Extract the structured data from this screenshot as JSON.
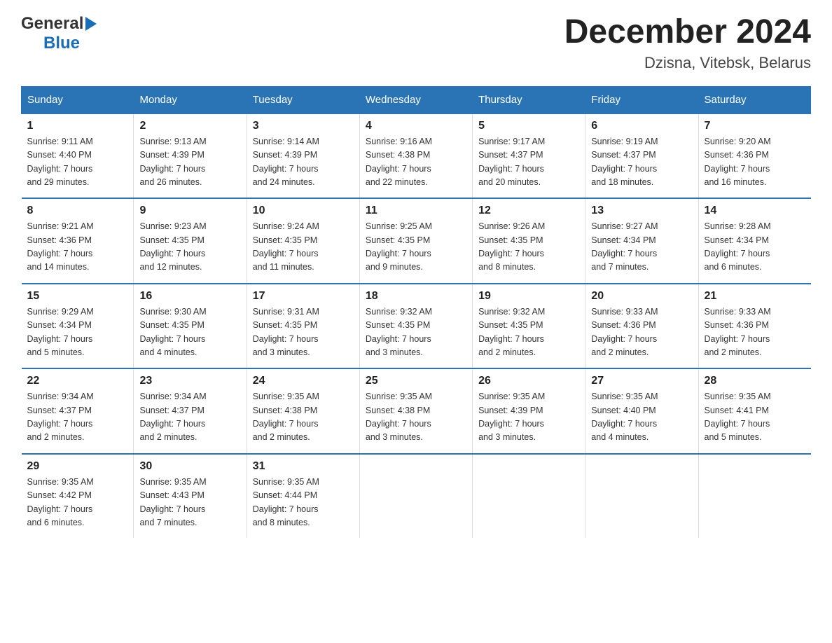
{
  "header": {
    "logo_general": "General",
    "logo_blue": "Blue",
    "title": "December 2024",
    "subtitle": "Dzisna, Vitebsk, Belarus"
  },
  "days_of_week": [
    "Sunday",
    "Monday",
    "Tuesday",
    "Wednesday",
    "Thursday",
    "Friday",
    "Saturday"
  ],
  "weeks": [
    [
      {
        "day": "1",
        "sunrise": "Sunrise: 9:11 AM",
        "sunset": "Sunset: 4:40 PM",
        "daylight": "Daylight: 7 hours",
        "daylight2": "and 29 minutes."
      },
      {
        "day": "2",
        "sunrise": "Sunrise: 9:13 AM",
        "sunset": "Sunset: 4:39 PM",
        "daylight": "Daylight: 7 hours",
        "daylight2": "and 26 minutes."
      },
      {
        "day": "3",
        "sunrise": "Sunrise: 9:14 AM",
        "sunset": "Sunset: 4:39 PM",
        "daylight": "Daylight: 7 hours",
        "daylight2": "and 24 minutes."
      },
      {
        "day": "4",
        "sunrise": "Sunrise: 9:16 AM",
        "sunset": "Sunset: 4:38 PM",
        "daylight": "Daylight: 7 hours",
        "daylight2": "and 22 minutes."
      },
      {
        "day": "5",
        "sunrise": "Sunrise: 9:17 AM",
        "sunset": "Sunset: 4:37 PM",
        "daylight": "Daylight: 7 hours",
        "daylight2": "and 20 minutes."
      },
      {
        "day": "6",
        "sunrise": "Sunrise: 9:19 AM",
        "sunset": "Sunset: 4:37 PM",
        "daylight": "Daylight: 7 hours",
        "daylight2": "and 18 minutes."
      },
      {
        "day": "7",
        "sunrise": "Sunrise: 9:20 AM",
        "sunset": "Sunset: 4:36 PM",
        "daylight": "Daylight: 7 hours",
        "daylight2": "and 16 minutes."
      }
    ],
    [
      {
        "day": "8",
        "sunrise": "Sunrise: 9:21 AM",
        "sunset": "Sunset: 4:36 PM",
        "daylight": "Daylight: 7 hours",
        "daylight2": "and 14 minutes."
      },
      {
        "day": "9",
        "sunrise": "Sunrise: 9:23 AM",
        "sunset": "Sunset: 4:35 PM",
        "daylight": "Daylight: 7 hours",
        "daylight2": "and 12 minutes."
      },
      {
        "day": "10",
        "sunrise": "Sunrise: 9:24 AM",
        "sunset": "Sunset: 4:35 PM",
        "daylight": "Daylight: 7 hours",
        "daylight2": "and 11 minutes."
      },
      {
        "day": "11",
        "sunrise": "Sunrise: 9:25 AM",
        "sunset": "Sunset: 4:35 PM",
        "daylight": "Daylight: 7 hours",
        "daylight2": "and 9 minutes."
      },
      {
        "day": "12",
        "sunrise": "Sunrise: 9:26 AM",
        "sunset": "Sunset: 4:35 PM",
        "daylight": "Daylight: 7 hours",
        "daylight2": "and 8 minutes."
      },
      {
        "day": "13",
        "sunrise": "Sunrise: 9:27 AM",
        "sunset": "Sunset: 4:34 PM",
        "daylight": "Daylight: 7 hours",
        "daylight2": "and 7 minutes."
      },
      {
        "day": "14",
        "sunrise": "Sunrise: 9:28 AM",
        "sunset": "Sunset: 4:34 PM",
        "daylight": "Daylight: 7 hours",
        "daylight2": "and 6 minutes."
      }
    ],
    [
      {
        "day": "15",
        "sunrise": "Sunrise: 9:29 AM",
        "sunset": "Sunset: 4:34 PM",
        "daylight": "Daylight: 7 hours",
        "daylight2": "and 5 minutes."
      },
      {
        "day": "16",
        "sunrise": "Sunrise: 9:30 AM",
        "sunset": "Sunset: 4:35 PM",
        "daylight": "Daylight: 7 hours",
        "daylight2": "and 4 minutes."
      },
      {
        "day": "17",
        "sunrise": "Sunrise: 9:31 AM",
        "sunset": "Sunset: 4:35 PM",
        "daylight": "Daylight: 7 hours",
        "daylight2": "and 3 minutes."
      },
      {
        "day": "18",
        "sunrise": "Sunrise: 9:32 AM",
        "sunset": "Sunset: 4:35 PM",
        "daylight": "Daylight: 7 hours",
        "daylight2": "and 3 minutes."
      },
      {
        "day": "19",
        "sunrise": "Sunrise: 9:32 AM",
        "sunset": "Sunset: 4:35 PM",
        "daylight": "Daylight: 7 hours",
        "daylight2": "and 2 minutes."
      },
      {
        "day": "20",
        "sunrise": "Sunrise: 9:33 AM",
        "sunset": "Sunset: 4:36 PM",
        "daylight": "Daylight: 7 hours",
        "daylight2": "and 2 minutes."
      },
      {
        "day": "21",
        "sunrise": "Sunrise: 9:33 AM",
        "sunset": "Sunset: 4:36 PM",
        "daylight": "Daylight: 7 hours",
        "daylight2": "and 2 minutes."
      }
    ],
    [
      {
        "day": "22",
        "sunrise": "Sunrise: 9:34 AM",
        "sunset": "Sunset: 4:37 PM",
        "daylight": "Daylight: 7 hours",
        "daylight2": "and 2 minutes."
      },
      {
        "day": "23",
        "sunrise": "Sunrise: 9:34 AM",
        "sunset": "Sunset: 4:37 PM",
        "daylight": "Daylight: 7 hours",
        "daylight2": "and 2 minutes."
      },
      {
        "day": "24",
        "sunrise": "Sunrise: 9:35 AM",
        "sunset": "Sunset: 4:38 PM",
        "daylight": "Daylight: 7 hours",
        "daylight2": "and 2 minutes."
      },
      {
        "day": "25",
        "sunrise": "Sunrise: 9:35 AM",
        "sunset": "Sunset: 4:38 PM",
        "daylight": "Daylight: 7 hours",
        "daylight2": "and 3 minutes."
      },
      {
        "day": "26",
        "sunrise": "Sunrise: 9:35 AM",
        "sunset": "Sunset: 4:39 PM",
        "daylight": "Daylight: 7 hours",
        "daylight2": "and 3 minutes."
      },
      {
        "day": "27",
        "sunrise": "Sunrise: 9:35 AM",
        "sunset": "Sunset: 4:40 PM",
        "daylight": "Daylight: 7 hours",
        "daylight2": "and 4 minutes."
      },
      {
        "day": "28",
        "sunrise": "Sunrise: 9:35 AM",
        "sunset": "Sunset: 4:41 PM",
        "daylight": "Daylight: 7 hours",
        "daylight2": "and 5 minutes."
      }
    ],
    [
      {
        "day": "29",
        "sunrise": "Sunrise: 9:35 AM",
        "sunset": "Sunset: 4:42 PM",
        "daylight": "Daylight: 7 hours",
        "daylight2": "and 6 minutes."
      },
      {
        "day": "30",
        "sunrise": "Sunrise: 9:35 AM",
        "sunset": "Sunset: 4:43 PM",
        "daylight": "Daylight: 7 hours",
        "daylight2": "and 7 minutes."
      },
      {
        "day": "31",
        "sunrise": "Sunrise: 9:35 AM",
        "sunset": "Sunset: 4:44 PM",
        "daylight": "Daylight: 7 hours",
        "daylight2": "and 8 minutes."
      },
      {
        "day": "",
        "sunrise": "",
        "sunset": "",
        "daylight": "",
        "daylight2": ""
      },
      {
        "day": "",
        "sunrise": "",
        "sunset": "",
        "daylight": "",
        "daylight2": ""
      },
      {
        "day": "",
        "sunrise": "",
        "sunset": "",
        "daylight": "",
        "daylight2": ""
      },
      {
        "day": "",
        "sunrise": "",
        "sunset": "",
        "daylight": "",
        "daylight2": ""
      }
    ]
  ]
}
